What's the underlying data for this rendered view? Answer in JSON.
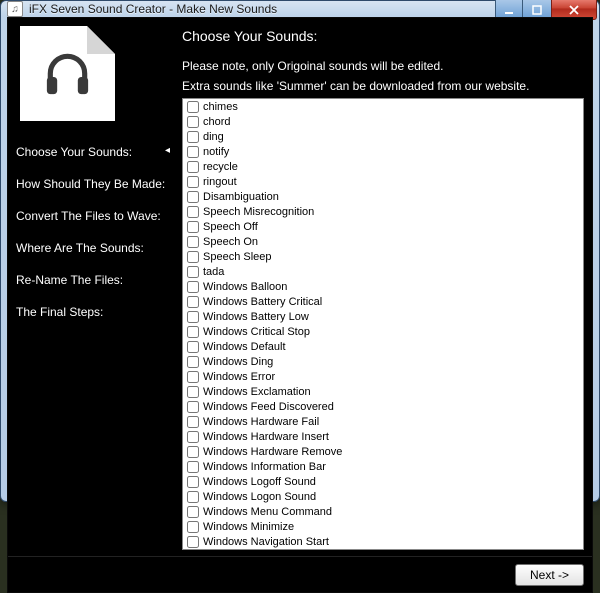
{
  "window": {
    "title": "iFX Seven Sound Creator - Make New Sounds"
  },
  "sidebar": {
    "items": [
      {
        "label": "Choose Your Sounds:",
        "active": true
      },
      {
        "label": "How Should They Be Made:",
        "active": false
      },
      {
        "label": "Convert The Files to Wave:",
        "active": false
      },
      {
        "label": "Where Are The Sounds:",
        "active": false
      },
      {
        "label": "Re-Name The Files:",
        "active": false
      },
      {
        "label": "The Final Steps:",
        "active": false
      }
    ]
  },
  "main": {
    "heading": "Choose Your Sounds:",
    "note_line1": "Please note, only Origoinal sounds will be edited.",
    "note_line2": "Extra sounds like 'Summer' can be downloaded from our website.",
    "sounds": [
      "chimes",
      "chord",
      "ding",
      "notify",
      "recycle",
      "ringout",
      "Disambiguation",
      "Speech Misrecognition",
      "Speech Off",
      "Speech On",
      "Speech Sleep",
      "tada",
      "Windows Balloon",
      "Windows Battery Critical",
      "Windows Battery Low",
      "Windows Critical Stop",
      "Windows Default",
      "Windows Ding",
      "Windows Error",
      "Windows Exclamation",
      "Windows Feed Discovered",
      "Windows Hardware Fail",
      "Windows Hardware Insert",
      "Windows Hardware Remove",
      "Windows Information Bar",
      "Windows Logoff Sound",
      "Windows Logon Sound",
      "Windows Menu Command",
      "Windows Minimize",
      "Windows Navigation Start"
    ]
  },
  "footer": {
    "next_label": "Next ->"
  }
}
